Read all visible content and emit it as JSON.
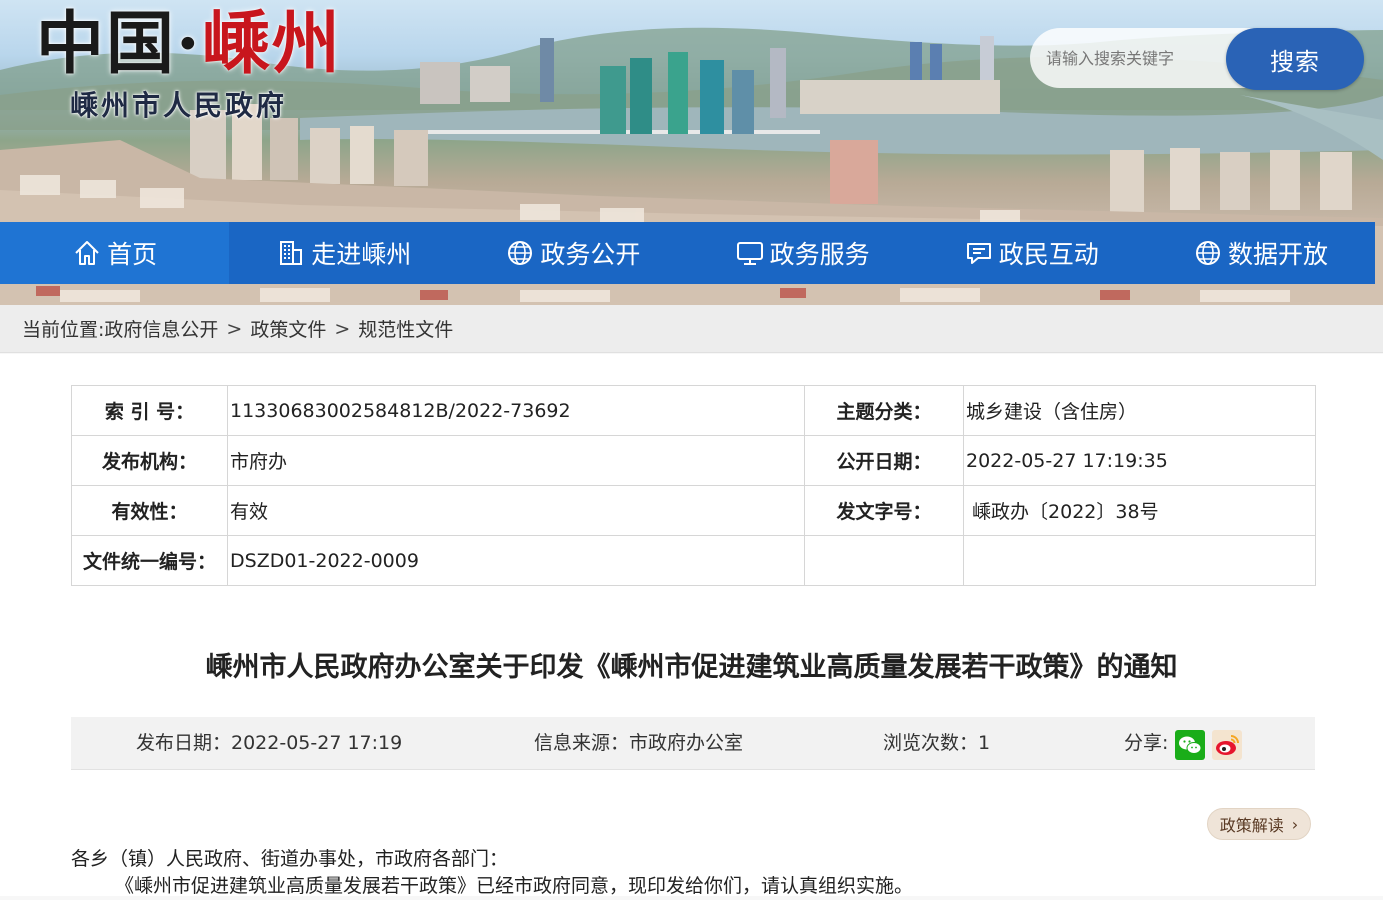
{
  "header": {
    "logo_main_1": "中国·",
    "logo_main_2": "嵊州",
    "logo_sub": "嵊州市人民政府",
    "search_placeholder": "请输入搜索关键字",
    "search_button": "搜索"
  },
  "nav": {
    "items": [
      {
        "label": "首页",
        "icon": "home-icon"
      },
      {
        "label": "走进嵊州",
        "icon": "building-icon"
      },
      {
        "label": "政务公开",
        "icon": "globe-icon"
      },
      {
        "label": "政务服务",
        "icon": "monitor-icon"
      },
      {
        "label": "政民互动",
        "icon": "chat-icon"
      },
      {
        "label": "数据开放",
        "icon": "globe-icon"
      }
    ]
  },
  "breadcrumb": {
    "prefix": "当前位置:",
    "items": [
      "政府信息公开",
      "政策文件",
      "规范性文件"
    ],
    "separator": ">"
  },
  "meta": {
    "index_label": "索 引 号：",
    "index_value": "11330683002584812B/2022-73692",
    "topic_label": "主题分类：",
    "topic_value": "城乡建设（含住房）",
    "publisher_label": "发布机构：",
    "publisher_value": "市府办",
    "open_date_label": "公开日期：",
    "open_date_value": "2022-05-27 17:19:35",
    "validity_label": "有效性：",
    "validity_value": "有效",
    "doc_no_label": "发文字号：",
    "doc_no_value": " 嵊政办〔2022〕38号",
    "unified_no_label": "文件统一编号：",
    "unified_no_value": "DSZD01-2022-0009"
  },
  "document": {
    "title": "嵊州市人民政府办公室关于印发《嵊州市促进建筑业高质量发展若干政策》的通知",
    "publish_date": "发布日期：2022-05-27 17:19",
    "source": "信息来源：市政府办公室",
    "views": "浏览次数：1",
    "share_label": "分享:",
    "policy_button": "政策解读",
    "body_line1": "各乡（镇）人民政府、街道办事处，市政府各部门：",
    "body_line2": "《嵊州市促进建筑业高质量发展若干政策》已经市政府同意，现印发给你们，请认真组织实施。"
  },
  "colors": {
    "nav_bg": "#1a66c4",
    "search_button_bg": "#2a63b6",
    "logo_red": "#c8161d",
    "wechat_green": "#1aad19",
    "weibo_red": "#e6162d"
  }
}
